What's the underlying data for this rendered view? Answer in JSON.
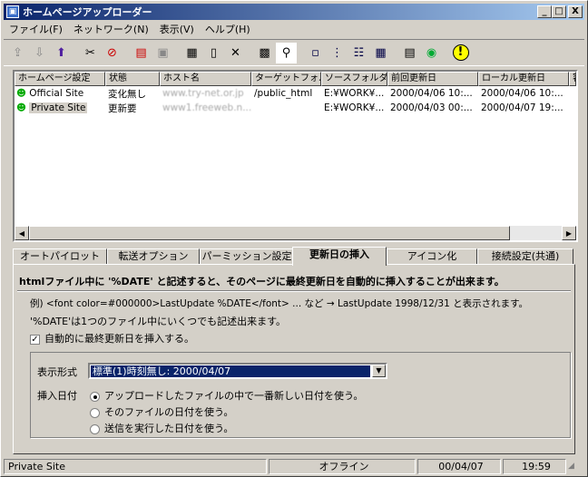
{
  "window": {
    "title": "ホームページアップローダー",
    "min": "_",
    "max": "□",
    "close": "X"
  },
  "menu": [
    "ファイル(F)",
    "ネットワーク(N)",
    "表示(V)",
    "ヘルプ(H)"
  ],
  "toolbar": {
    "icons": [
      "upload-icon",
      "download-icon",
      "up-arrow-icon",
      "cut-icon",
      "stop-icon",
      "send-icon",
      "receive-icon",
      "properties-icon",
      "new-icon",
      "delete-icon",
      "settings-icon",
      "search-icon",
      "large-icons-icon",
      "small-icons-icon",
      "list-icon",
      "details-icon",
      "log-icon",
      "web-icon",
      "info-icon"
    ]
  },
  "list": {
    "columns": [
      "ホームページ設定",
      "状態",
      "ホスト名",
      "ターゲットフォル...",
      "ソースフォルダ",
      "前回更新日",
      "ローカル更新日",
      "容"
    ],
    "rows": [
      {
        "name": "Official Site",
        "status": "変化無し",
        "host": "www.try-net.or.jp",
        "target": "/public_html",
        "source": "E:¥WORK¥...",
        "last": "2000/04/06 10:...",
        "local": "2000/04/06 10:..."
      },
      {
        "name": "Private Site",
        "status": "更新要",
        "host": "www1.freeweb.n...",
        "target": "",
        "source": "E:¥WORK¥...",
        "last": "2000/04/03 00:...",
        "local": "2000/04/07 19:..."
      }
    ]
  },
  "tabs": [
    "オートパイロット",
    "転送オプション",
    "パーミッション設定",
    "更新日の挿入",
    "アイコン化",
    "接続設定(共通)"
  ],
  "panel": {
    "heading": "htmlファイル中に '%DATE' と記述すると、そのページに最終更新日を自動的に挿入することが出来ます。",
    "example": "例) <font color=#000000>LastUpdate %DATE</font> ... など  →  LastUpdate 1998/12/31 と表示されます。",
    "note": "'%DATE'は1つのファイル中にいくつでも記述出来ます。",
    "checkbox": "自動的に最終更新日を挿入する。",
    "format_label": "表示形式",
    "format_value": "標準(1)時刻無し: 2000/04/07",
    "date_label": "挿入日付",
    "radio1": "アップロードしたファイルの中で一番新しい日付を使う。",
    "radio2": "そのファイルの日付を使う。",
    "radio3": "送信を実行した日付を使う。"
  },
  "status": {
    "site": "Private Site",
    "conn": "オフライン",
    "date": "00/04/07",
    "time": "19:59"
  }
}
